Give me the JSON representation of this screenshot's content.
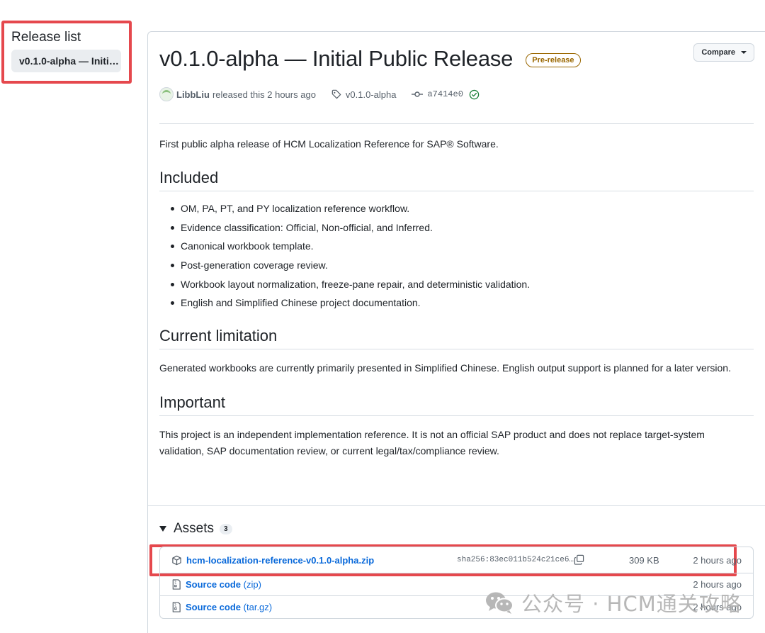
{
  "sidebar": {
    "title": "Release list",
    "items": [
      {
        "label": "v0.1.0-alpha — Initial..."
      }
    ]
  },
  "release": {
    "title": "v0.1.0-alpha — Initial Public Release",
    "badge": "Pre-release",
    "compare_label": "Compare",
    "author": "LibbLiu",
    "released_text": "released this 2 hours ago",
    "tag": "v0.1.0-alpha",
    "commit": "a7414e0"
  },
  "body": {
    "intro": "First public alpha release of HCM Localization Reference for SAP® Software.",
    "included_heading": "Included",
    "included_items": [
      "OM, PA, PT, and PY localization reference workflow.",
      "Evidence classification: Official, Non-official, and Inferred.",
      "Canonical workbook template.",
      "Post-generation coverage review.",
      "Workbook layout normalization, freeze-pane repair, and deterministic validation.",
      "English and Simplified Chinese project documentation."
    ],
    "limitation_heading": "Current limitation",
    "limitation_text": "Generated workbooks are currently primarily presented in Simplified Chinese. English output support is planned for a later version.",
    "important_heading": "Important",
    "important_text": "This project is an independent implementation reference. It is not an official SAP product and does not replace target-system validation, SAP documentation review, or current legal/tax/compliance review."
  },
  "assets": {
    "heading": "Assets",
    "count": "3",
    "items": [
      {
        "name": "hcm-localization-reference-v0.1.0-alpha.zip",
        "sha": "sha256:83ec011b524c21ce6…",
        "size": "309 KB",
        "time": "2 hours ago"
      },
      {
        "name": "Source code",
        "suffix": "(zip)",
        "time": "2 hours ago"
      },
      {
        "name": "Source code",
        "suffix": "(tar.gz)",
        "time": "2 hours ago"
      }
    ]
  },
  "watermark": {
    "text": "公众号 · HCM通关攻略"
  },
  "colors": {
    "link": "#0969da",
    "badge": "#9a6700",
    "highlight": "#e5484d",
    "check": "#1a7f37"
  }
}
